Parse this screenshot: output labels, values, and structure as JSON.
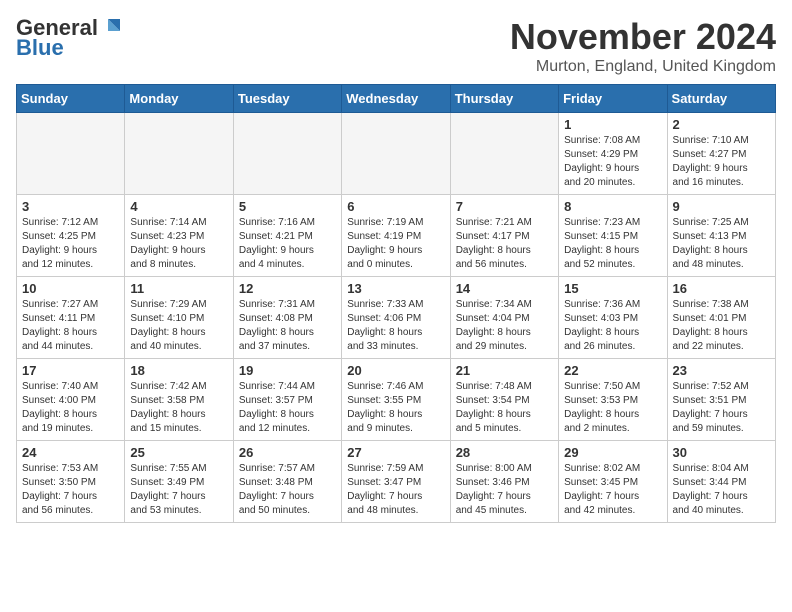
{
  "logo": {
    "line1": "General",
    "line2": "Blue"
  },
  "title": "November 2024",
  "subtitle": "Murton, England, United Kingdom",
  "weekdays": [
    "Sunday",
    "Monday",
    "Tuesday",
    "Wednesday",
    "Thursday",
    "Friday",
    "Saturday"
  ],
  "weeks": [
    [
      {
        "day": "",
        "info": ""
      },
      {
        "day": "",
        "info": ""
      },
      {
        "day": "",
        "info": ""
      },
      {
        "day": "",
        "info": ""
      },
      {
        "day": "",
        "info": ""
      },
      {
        "day": "1",
        "info": "Sunrise: 7:08 AM\nSunset: 4:29 PM\nDaylight: 9 hours\nand 20 minutes."
      },
      {
        "day": "2",
        "info": "Sunrise: 7:10 AM\nSunset: 4:27 PM\nDaylight: 9 hours\nand 16 minutes."
      }
    ],
    [
      {
        "day": "3",
        "info": "Sunrise: 7:12 AM\nSunset: 4:25 PM\nDaylight: 9 hours\nand 12 minutes."
      },
      {
        "day": "4",
        "info": "Sunrise: 7:14 AM\nSunset: 4:23 PM\nDaylight: 9 hours\nand 8 minutes."
      },
      {
        "day": "5",
        "info": "Sunrise: 7:16 AM\nSunset: 4:21 PM\nDaylight: 9 hours\nand 4 minutes."
      },
      {
        "day": "6",
        "info": "Sunrise: 7:19 AM\nSunset: 4:19 PM\nDaylight: 9 hours\nand 0 minutes."
      },
      {
        "day": "7",
        "info": "Sunrise: 7:21 AM\nSunset: 4:17 PM\nDaylight: 8 hours\nand 56 minutes."
      },
      {
        "day": "8",
        "info": "Sunrise: 7:23 AM\nSunset: 4:15 PM\nDaylight: 8 hours\nand 52 minutes."
      },
      {
        "day": "9",
        "info": "Sunrise: 7:25 AM\nSunset: 4:13 PM\nDaylight: 8 hours\nand 48 minutes."
      }
    ],
    [
      {
        "day": "10",
        "info": "Sunrise: 7:27 AM\nSunset: 4:11 PM\nDaylight: 8 hours\nand 44 minutes."
      },
      {
        "day": "11",
        "info": "Sunrise: 7:29 AM\nSunset: 4:10 PM\nDaylight: 8 hours\nand 40 minutes."
      },
      {
        "day": "12",
        "info": "Sunrise: 7:31 AM\nSunset: 4:08 PM\nDaylight: 8 hours\nand 37 minutes."
      },
      {
        "day": "13",
        "info": "Sunrise: 7:33 AM\nSunset: 4:06 PM\nDaylight: 8 hours\nand 33 minutes."
      },
      {
        "day": "14",
        "info": "Sunrise: 7:34 AM\nSunset: 4:04 PM\nDaylight: 8 hours\nand 29 minutes."
      },
      {
        "day": "15",
        "info": "Sunrise: 7:36 AM\nSunset: 4:03 PM\nDaylight: 8 hours\nand 26 minutes."
      },
      {
        "day": "16",
        "info": "Sunrise: 7:38 AM\nSunset: 4:01 PM\nDaylight: 8 hours\nand 22 minutes."
      }
    ],
    [
      {
        "day": "17",
        "info": "Sunrise: 7:40 AM\nSunset: 4:00 PM\nDaylight: 8 hours\nand 19 minutes."
      },
      {
        "day": "18",
        "info": "Sunrise: 7:42 AM\nSunset: 3:58 PM\nDaylight: 8 hours\nand 15 minutes."
      },
      {
        "day": "19",
        "info": "Sunrise: 7:44 AM\nSunset: 3:57 PM\nDaylight: 8 hours\nand 12 minutes."
      },
      {
        "day": "20",
        "info": "Sunrise: 7:46 AM\nSunset: 3:55 PM\nDaylight: 8 hours\nand 9 minutes."
      },
      {
        "day": "21",
        "info": "Sunrise: 7:48 AM\nSunset: 3:54 PM\nDaylight: 8 hours\nand 5 minutes."
      },
      {
        "day": "22",
        "info": "Sunrise: 7:50 AM\nSunset: 3:53 PM\nDaylight: 8 hours\nand 2 minutes."
      },
      {
        "day": "23",
        "info": "Sunrise: 7:52 AM\nSunset: 3:51 PM\nDaylight: 7 hours\nand 59 minutes."
      }
    ],
    [
      {
        "day": "24",
        "info": "Sunrise: 7:53 AM\nSunset: 3:50 PM\nDaylight: 7 hours\nand 56 minutes."
      },
      {
        "day": "25",
        "info": "Sunrise: 7:55 AM\nSunset: 3:49 PM\nDaylight: 7 hours\nand 53 minutes."
      },
      {
        "day": "26",
        "info": "Sunrise: 7:57 AM\nSunset: 3:48 PM\nDaylight: 7 hours\nand 50 minutes."
      },
      {
        "day": "27",
        "info": "Sunrise: 7:59 AM\nSunset: 3:47 PM\nDaylight: 7 hours\nand 48 minutes."
      },
      {
        "day": "28",
        "info": "Sunrise: 8:00 AM\nSunset: 3:46 PM\nDaylight: 7 hours\nand 45 minutes."
      },
      {
        "day": "29",
        "info": "Sunrise: 8:02 AM\nSunset: 3:45 PM\nDaylight: 7 hours\nand 42 minutes."
      },
      {
        "day": "30",
        "info": "Sunrise: 8:04 AM\nSunset: 3:44 PM\nDaylight: 7 hours\nand 40 minutes."
      }
    ]
  ]
}
